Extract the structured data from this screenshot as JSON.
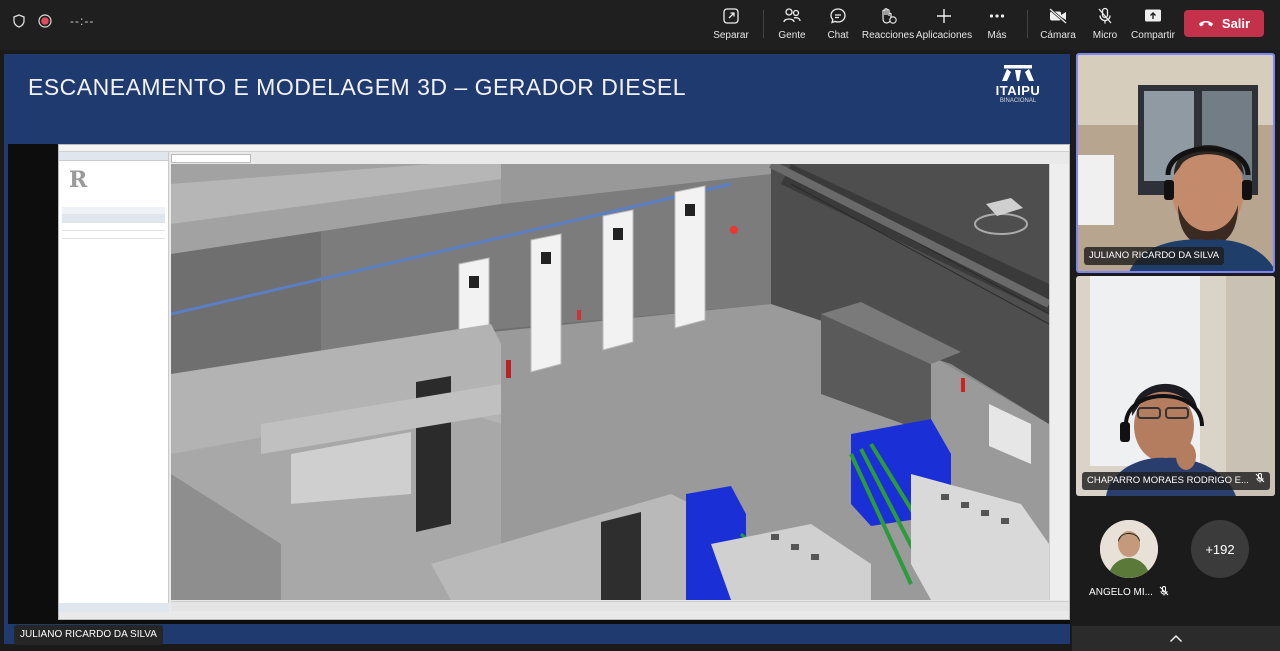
{
  "call": {
    "timer": "--:--",
    "toolbar": [
      {
        "id": "separar",
        "label": "Separar",
        "icon": "pop-out-icon"
      },
      {
        "id": "gente",
        "label": "Gente",
        "icon": "people-icon"
      },
      {
        "id": "chat",
        "label": "Chat",
        "icon": "chat-icon"
      },
      {
        "id": "reacciones",
        "label": "Reacciones",
        "icon": "reactions-icon"
      },
      {
        "id": "aplicaciones",
        "label": "Aplicaciones",
        "icon": "plus-icon"
      },
      {
        "id": "mas",
        "label": "Más",
        "icon": "more-icon"
      },
      {
        "id": "camara",
        "label": "Cámara",
        "icon": "camera-off-icon"
      },
      {
        "id": "micro",
        "label": "Micro",
        "icon": "mic-off-icon"
      },
      {
        "id": "compartir",
        "label": "Compartir",
        "icon": "share-icon"
      }
    ],
    "leave_label": "Salir",
    "leave_color": "#c4314b"
  },
  "slide": {
    "title": "ESCANEAMENTO E MODELAGEM 3D – GERADOR DIESEL",
    "logo_name": "ITAIPU",
    "logo_sub": "BINACIONAL",
    "bg_color": "#1f3a6e"
  },
  "presenter_label": "JULIANO RICARDO DA SILVA",
  "participants": {
    "tile1_name": "JULIANO RICARDO DA SILVA",
    "tile2_name": "CHAPARRO MORAES RODRIGO E...",
    "small_name": "ANGELO MI...",
    "more_count": "+192"
  }
}
